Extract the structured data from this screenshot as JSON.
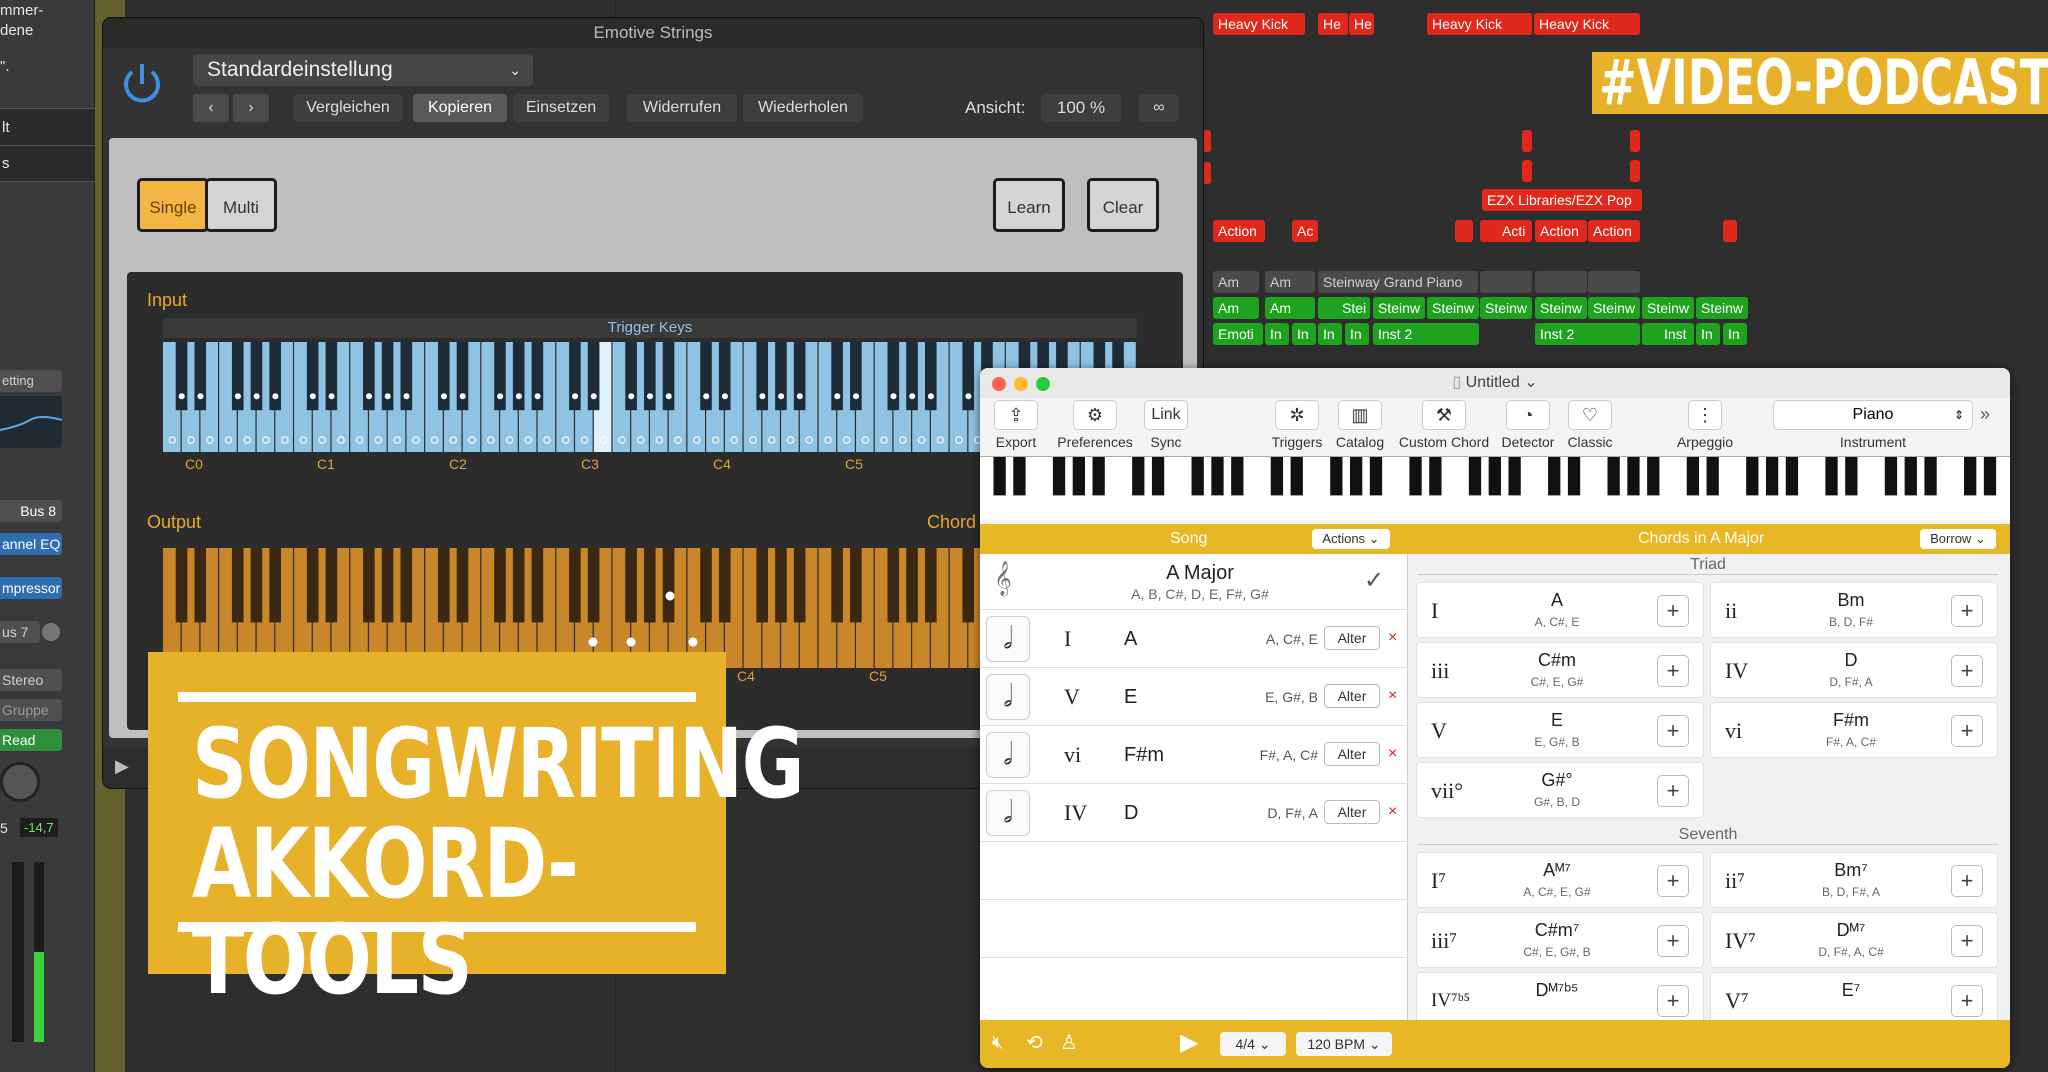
{
  "left_strip": {
    "top_text_1": "mmer-",
    "top_text_2": "dene",
    "top_text_3": "\".",
    "item_lt": "lt",
    "item_s": "s",
    "setting": "etting",
    "bus8": "Bus 8",
    "channel_eq": "annel EQ",
    "compressor": "mpressor",
    "bus7": "us 7",
    "stereo": "Stereo",
    "gruppe": "Gruppe",
    "read": "Read",
    "val_5": "5",
    "val_db": "-14,7"
  },
  "arrange": {
    "top_regions": [
      {
        "label": "Heavy Kick",
        "kind": "red"
      },
      {
        "label": "He",
        "kind": "red"
      },
      {
        "label": "He",
        "kind": "red"
      },
      {
        "label": "Heavy Kick",
        "kind": "red"
      },
      {
        "label": "Heavy Kick",
        "kind": "red"
      }
    ],
    "ezx": "EZX Libraries/EZX Pop",
    "action_regions": [
      "Action",
      "Ac",
      "Acti",
      "Action",
      "Action"
    ],
    "am_gray": [
      "Am",
      "Am",
      "Steinway Grand Piano"
    ],
    "green_row": [
      "Am",
      "Am",
      "Stei",
      "Steinw",
      "Steinw",
      "Steinw",
      "Steinw",
      "Steinw",
      "Steinw",
      "Steinw"
    ],
    "inst_row": [
      "Emoti",
      "In",
      "In",
      "In",
      "In",
      "Inst 2",
      "Inst 2",
      "Inst",
      "In",
      "In"
    ]
  },
  "plugin": {
    "title": "Emotive Strings",
    "preset": "Standardeinstellung",
    "buttons": [
      "Vergleichen",
      "Kopieren",
      "Einsetzen",
      "Widerrufen",
      "Wiederholen"
    ],
    "view_label": "Ansicht:",
    "view_value": "100 %",
    "single": "Single",
    "multi": "Multi",
    "learn": "Learn",
    "clear": "Clear",
    "input_label": "Input",
    "trigger_keys": "Trigger Keys",
    "output_label": "Output",
    "chord_label": "Chord T",
    "octaves_in": [
      "C0",
      "C1",
      "C2",
      "C3",
      "C4",
      "C5"
    ],
    "octaves_out": [
      "C4",
      "C5"
    ]
  },
  "overlay": {
    "line1": "SONGWRITING",
    "line2": "AKKORD-TOOLS",
    "podcast": "#VIDEO-PODCAST"
  },
  "app": {
    "title": "Untitled",
    "toolbar": [
      {
        "label": "Export",
        "icon": "share-icon",
        "glyph": "⇪"
      },
      {
        "label": "Preferences",
        "icon": "gear-icon",
        "glyph": "⚙"
      },
      {
        "label": "Sync",
        "icon": "link-icon",
        "glyph": "Link"
      },
      {
        "label": "Triggers",
        "icon": "triggers-icon",
        "glyph": "✲"
      },
      {
        "label": "Catalog",
        "icon": "book-icon",
        "glyph": "▥"
      },
      {
        "label": "Custom Chord",
        "icon": "hammer-icon",
        "glyph": "⚒"
      },
      {
        "label": "Detector",
        "icon": "ear-icon",
        "glyph": "◔"
      },
      {
        "label": "Classic",
        "icon": "heart-icon",
        "glyph": "♡"
      },
      {
        "label": "Arpeggio",
        "icon": "arpeggio-icon",
        "glyph": "⋮"
      }
    ],
    "instrument_value": "Piano",
    "instrument_label": "Instrument",
    "song_header": "Song",
    "actions": "Actions",
    "chords_header": "Chords in A Major",
    "borrow": "Borrow",
    "key_name": "A Major",
    "key_notes": "A, B, C#, D, E, F#, G#",
    "song_rows": [
      {
        "roman": "I",
        "chord": "A",
        "notes": "A, C#, E"
      },
      {
        "roman": "V",
        "chord": "E",
        "notes": "E, G#, B"
      },
      {
        "roman": "vi",
        "chord": "F#m",
        "notes": "F#, A, C#"
      },
      {
        "roman": "IV",
        "chord": "D",
        "notes": "D, F#, A"
      }
    ],
    "alter": "Alter",
    "triad_label": "Triad",
    "seventh_label": "Seventh",
    "triads": [
      {
        "roman": "I",
        "name": "A",
        "notes": "A, C#, E"
      },
      {
        "roman": "ii",
        "name": "Bm",
        "notes": "B, D, F#"
      },
      {
        "roman": "iii",
        "name": "C#m",
        "notes": "C#, E, G#"
      },
      {
        "roman": "IV",
        "name": "D",
        "notes": "D, F#, A"
      },
      {
        "roman": "V",
        "name": "E",
        "notes": "E, G#, B"
      },
      {
        "roman": "vi",
        "name": "F#m",
        "notes": "F#, A, C#"
      },
      {
        "roman": "vii°",
        "name": "G#°",
        "notes": "G#, B, D"
      }
    ],
    "sevenths": [
      {
        "roman": "I⁷",
        "name": "Aᴹ⁷",
        "notes": "A, C#, E, G#"
      },
      {
        "roman": "ii⁷",
        "name": "Bm⁷",
        "notes": "B, D, F#, A"
      },
      {
        "roman": "iii⁷",
        "name": "C#m⁷",
        "notes": "C#, E, G#, B"
      },
      {
        "roman": "IV⁷",
        "name": "Dᴹ⁷",
        "notes": "D, F#, A, C#"
      },
      {
        "roman": "IV⁷ᵇ⁵",
        "name": "Dᴹ⁷ᵇ⁵",
        "notes": ""
      },
      {
        "roman": "V⁷",
        "name": "E⁷",
        "notes": ""
      }
    ],
    "time_sig": "4/4",
    "bpm": "120 BPM"
  },
  "colors": {
    "yellow": "#e8b726",
    "region_red": "#e0281c",
    "region_green": "#1ea31e",
    "key_blue": "#8fc3e4",
    "key_orange": "#c9872a"
  }
}
